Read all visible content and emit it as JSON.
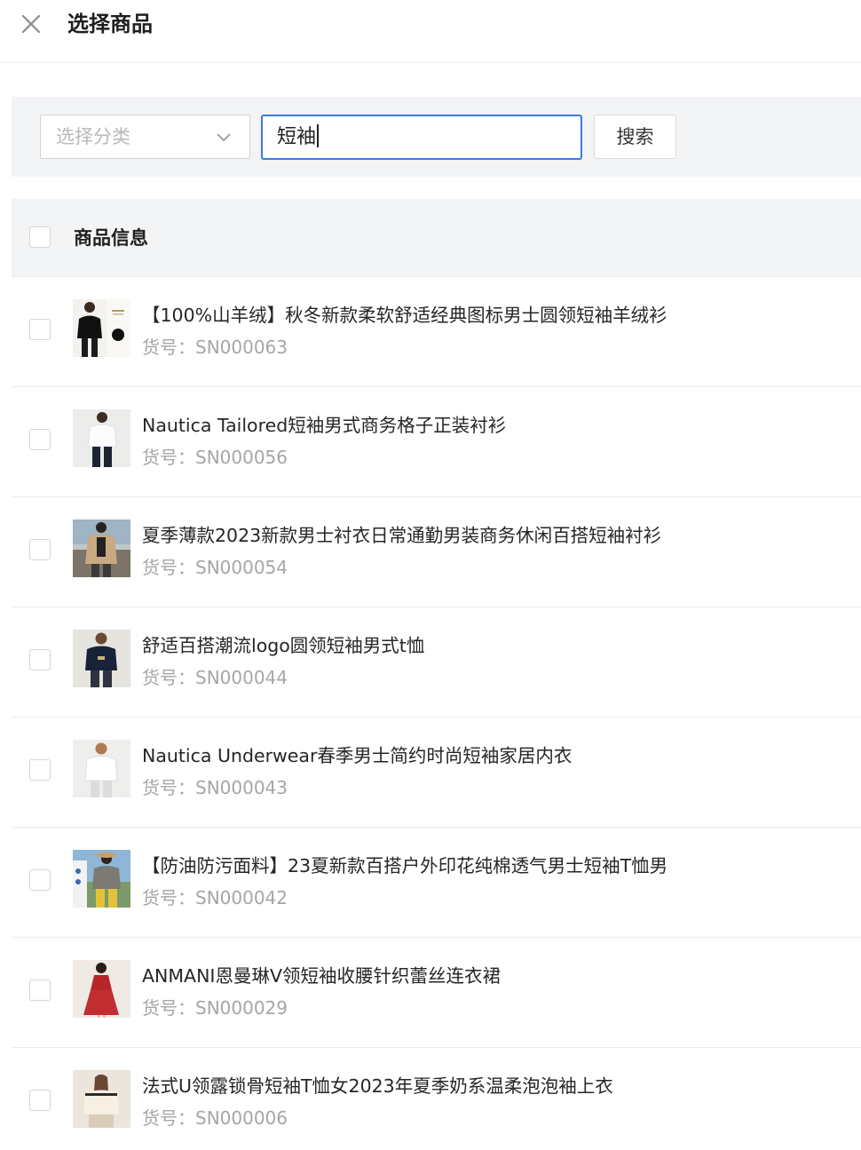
{
  "header": {
    "title": "选择商品",
    "close_icon": "close-icon"
  },
  "search": {
    "category_placeholder": "选择分类",
    "keyword_value": "短袖",
    "button_label": "搜索"
  },
  "table": {
    "header_label": "商品信息"
  },
  "products": [
    {
      "name": "【100%山羊绒】秋冬新款柔软舒适经典图标男士圆领短袖羊绒衫",
      "sku_label": "货号：",
      "sku": "SN000063"
    },
    {
      "name": "Nautica Tailored短袖男式商务格子正装衬衫",
      "sku_label": "货号：",
      "sku": "SN000056"
    },
    {
      "name": "夏季薄款2023新款男士衬衣日常通勤男装商务休闲百搭短袖衬衫",
      "sku_label": "货号：",
      "sku": "SN000054"
    },
    {
      "name": "舒适百搭潮流logo圆领短袖男式t恤",
      "sku_label": "货号：",
      "sku": "SN000044"
    },
    {
      "name": "Nautica Underwear春季男士简约时尚短袖家居内衣",
      "sku_label": "货号：",
      "sku": "SN000043"
    },
    {
      "name": "【防油防污面料】23夏新款百搭户外印花纯棉透气男士短袖T恤男",
      "sku_label": "货号：",
      "sku": "SN000042"
    },
    {
      "name": "ANMANI恩曼琳V领短袖收腰针织蕾丝连衣裙",
      "sku_label": "货号：",
      "sku": "SN000029"
    },
    {
      "name": "法式U领露锁骨短袖T恤女2023年夏季奶系温柔泡泡袖上衣",
      "sku_label": "货号：",
      "sku": "SN000006"
    }
  ],
  "colors": {
    "accent": "#3a7be0",
    "panel_bg": "#f3f4f6"
  }
}
